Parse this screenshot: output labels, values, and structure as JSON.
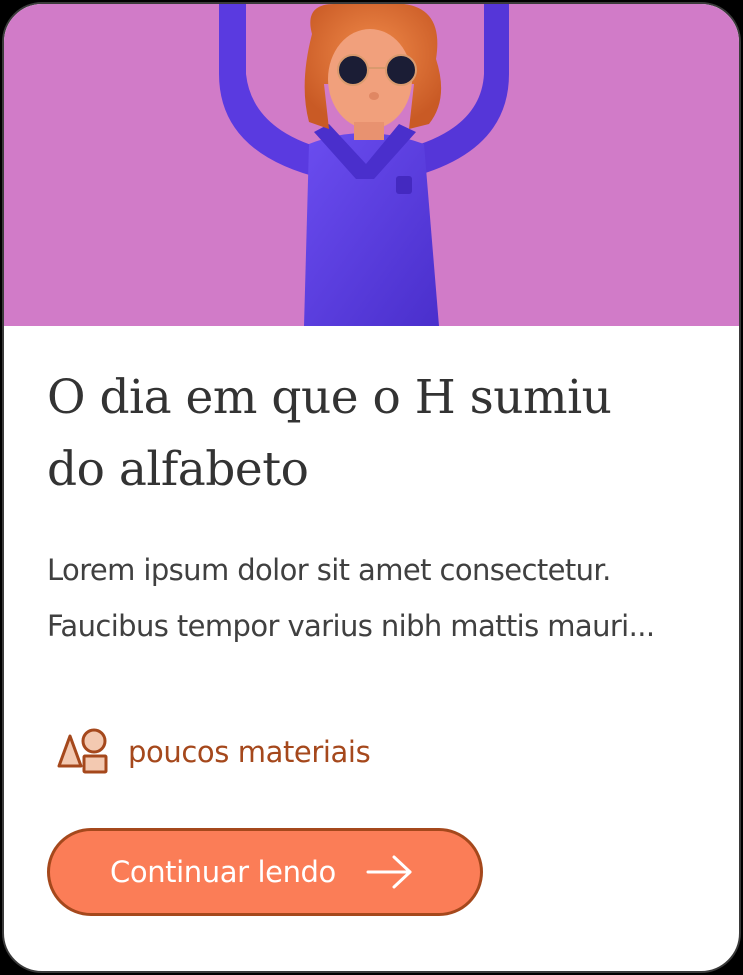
{
  "card": {
    "hero_image": "illustration-person-purple-shirt-sunglasses-arms-raised",
    "title_line1": "O dia em que o H sumiu",
    "title_line2": "do alfabeto",
    "excerpt_line1": "Lorem ipsum dolor sit amet consectetur.",
    "excerpt_line2": "Faucibus tempor varius nibh mattis mauri...",
    "materials_icon": "shapes-icon",
    "materials_label": "poucos materiais",
    "cta_label": "Continuar lendo",
    "cta_icon": "arrow-right-icon"
  },
  "colors": {
    "hero_background": "#d17bc8",
    "accent": "#fb7d57",
    "accent_border": "#a5481c",
    "text_primary": "#333333"
  }
}
